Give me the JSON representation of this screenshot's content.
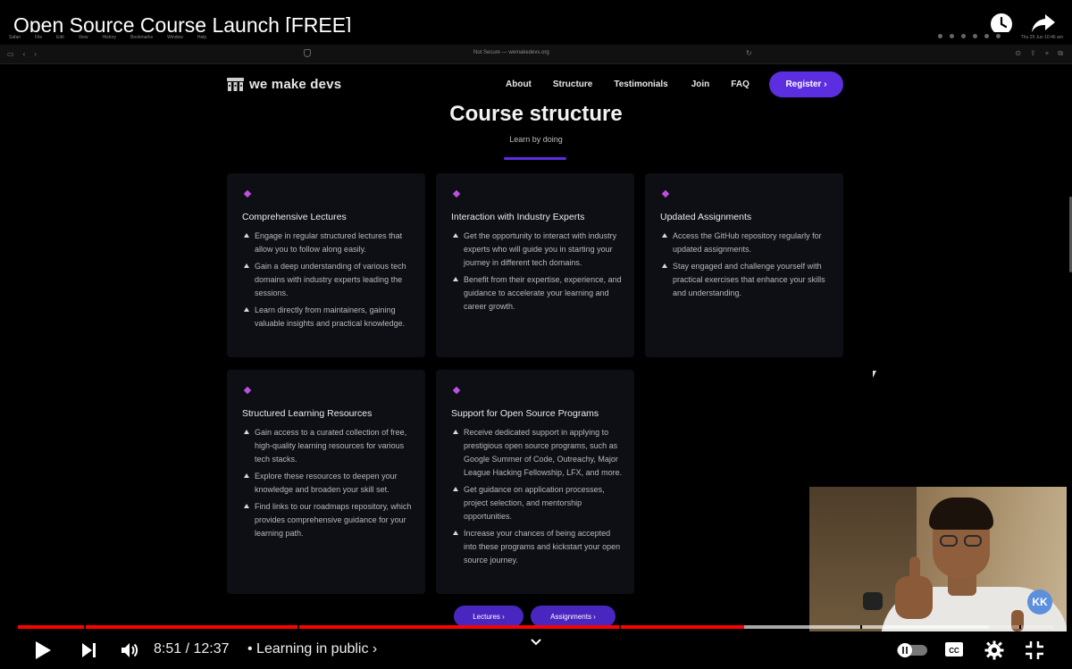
{
  "video": {
    "title": "Open Source Course Launch [FREE]",
    "time_current": "8:51",
    "time_total": "12:37",
    "time_display": "8:51 / 12:37",
    "chapter": "• Learning in public ›",
    "progress_fraction": 0.701,
    "buffered_fraction": 0.937,
    "chapter_marks": [
      0.064,
      0.27,
      0.58,
      0.813,
      0.966
    ]
  },
  "menubar": {
    "items": [
      "Safari",
      "File",
      "Edit",
      "View",
      "History",
      "Bookmarks",
      "Window",
      "Help"
    ],
    "clock": "Thu 29 Jun  10:46 am"
  },
  "browser": {
    "address": "Not Secure — wemakedevs.org"
  },
  "site": {
    "logo_text": "we make devs",
    "nav": [
      "About",
      "Structure",
      "Testimonials",
      "Join",
      "FAQ"
    ],
    "register_label": "Register ›",
    "heading": "Course structure",
    "subheading": "Learn by doing",
    "cards": [
      {
        "title": "Comprehensive Lectures",
        "items": [
          "Engage in regular structured lectures that allow you to follow along easily.",
          "Gain a deep understanding of various tech domains with industry experts leading the sessions.",
          "Learn directly from maintainers, gaining valuable insights and practical knowledge."
        ]
      },
      {
        "title": "Interaction with Industry Experts",
        "items": [
          "Get the opportunity to interact with industry experts who will guide you in starting your journey in different tech domains.",
          "Benefit from their expertise, experience, and guidance to accelerate your learning and career growth."
        ]
      },
      {
        "title": "Updated Assignments",
        "items": [
          "Access the GitHub repository regularly for updated assignments.",
          "Stay engaged and challenge yourself with practical exercises that enhance your skills and understanding."
        ]
      },
      {
        "title": "Structured Learning Resources",
        "items": [
          "Gain access to a curated collection of free, high-quality learning resources for various tech stacks.",
          "Explore these resources to deepen your knowledge and broaden your skill set.",
          "Find links to our roadmaps repository, which provides comprehensive guidance for your learning path."
        ]
      },
      {
        "title": "Support for Open Source Programs",
        "items": [
          "Receive dedicated support in applying to prestigious open source programs, such as Google Summer of Code, Outreachy, Major League Hacking Fellowship, LFX, and more.",
          "Get guidance on application processes, project selection, and mentorship opportunities.",
          "Increase your chances of being accepted into these programs and kickstart your open source journey."
        ]
      }
    ],
    "pills": [
      "Lectures ›",
      "Assignments ›"
    ]
  },
  "webcam": {
    "badge": "KK"
  },
  "colors": {
    "accent": "#5b2ee0",
    "progress_red": "#ff0000",
    "card_bg": "#0d0f14",
    "diamond": "#c04fe0"
  }
}
